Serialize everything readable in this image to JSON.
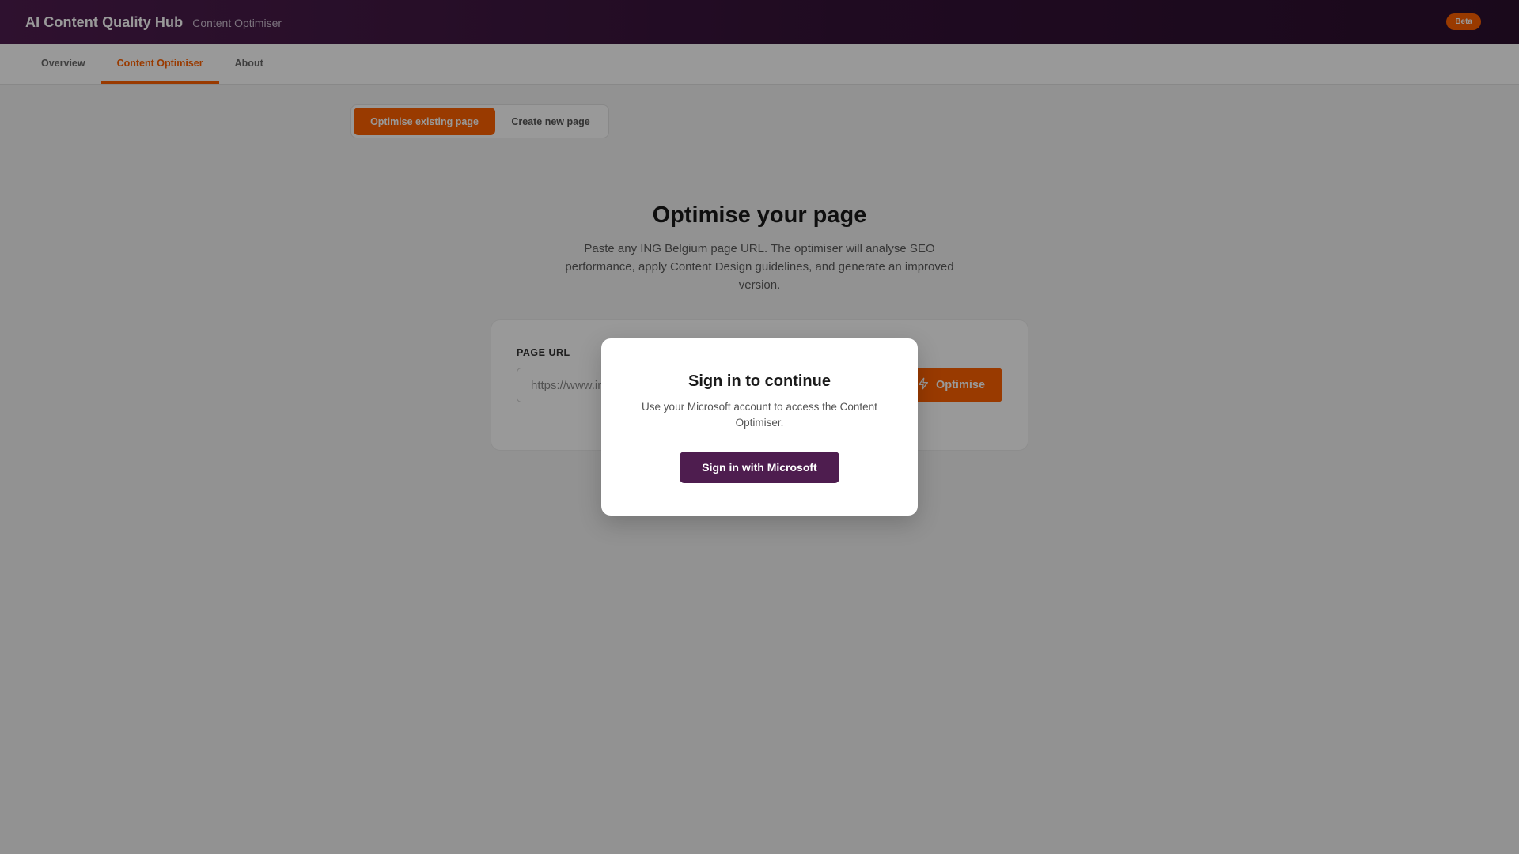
{
  "header": {
    "title": "AI Content Quality Hub",
    "subtitle": "Content Optimiser",
    "badge": "Beta"
  },
  "nav": {
    "tabs": [
      {
        "label": "Overview",
        "active": false
      },
      {
        "label": "Content Optimiser",
        "active": true
      },
      {
        "label": "About",
        "active": false
      }
    ]
  },
  "mode_switch": {
    "options": [
      {
        "label": "Optimise existing page",
        "active": true
      },
      {
        "label": "Create new page",
        "active": false
      }
    ]
  },
  "hero": {
    "title": "Optimise your page",
    "description": "Paste any ING Belgium page URL. The optimiser will analyse SEO performance, apply Content Design guidelines, and generate an improved version."
  },
  "url_form": {
    "label": "PAGE URL",
    "placeholder": "https://www.ing.be/...",
    "value": "",
    "submit_label": "Optimise",
    "submit_icon": "lightning-icon"
  },
  "modal": {
    "title": "Sign in to continue",
    "message": "Use your Microsoft account to access the Content Optimiser.",
    "button_label": "Sign in with Microsoft"
  },
  "colors": {
    "brand_purple": "#4e1d4f",
    "accent_orange": "#ff6200"
  }
}
